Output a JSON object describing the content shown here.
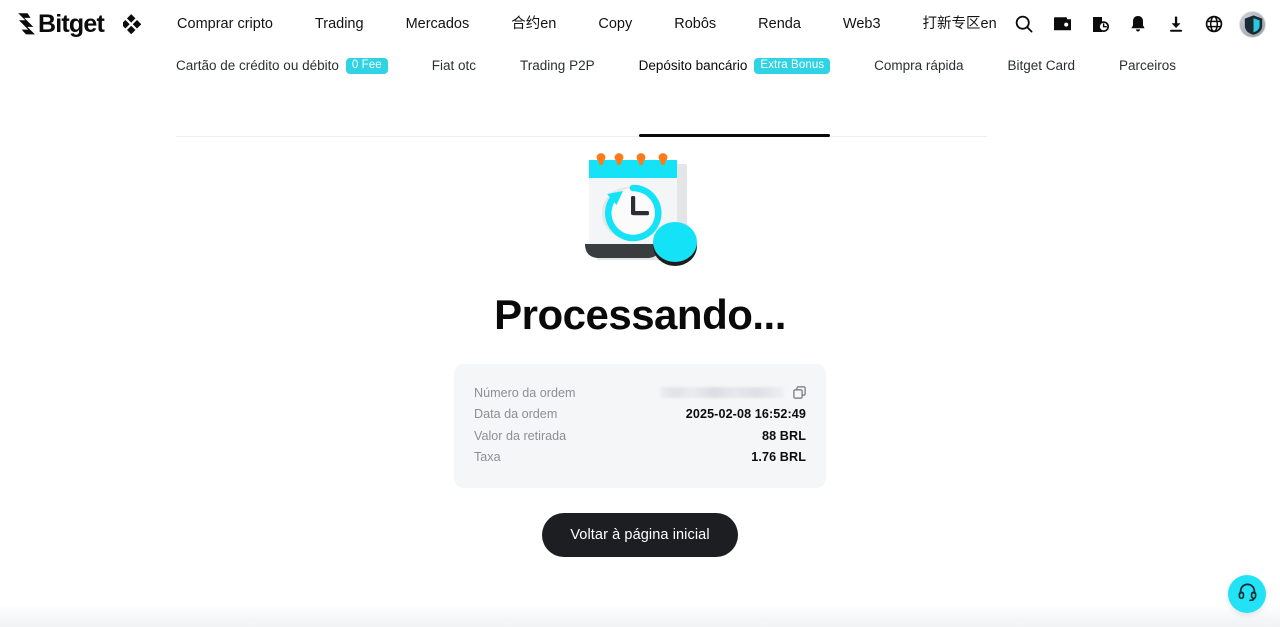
{
  "header": {
    "logo_text": "Bitget",
    "logo_icon": "bitget-logo-mark",
    "apps_icon": "diamond-grid-icon",
    "nav": [
      {
        "label": "Comprar cripto"
      },
      {
        "label": "Trading"
      },
      {
        "label": "Mercados"
      },
      {
        "label": "合约en"
      },
      {
        "label": "Copy"
      },
      {
        "label": "Robôs"
      },
      {
        "label": "Renda"
      },
      {
        "label": "Web3"
      },
      {
        "label": "打新专区en"
      }
    ],
    "icons": [
      {
        "name": "search-icon"
      },
      {
        "name": "wallet-icon"
      },
      {
        "name": "order-history-icon"
      },
      {
        "name": "notification-bell-icon"
      },
      {
        "name": "download-icon"
      },
      {
        "name": "globe-language-icon"
      }
    ],
    "avatar": {
      "name": "user-avatar"
    }
  },
  "tabs": [
    {
      "label": "Cartão de crédito ou débito",
      "badge": "0 Fee",
      "active": false
    },
    {
      "label": "Fiat otc",
      "badge": "",
      "active": false
    },
    {
      "label": "Trading P2P",
      "badge": "",
      "active": false
    },
    {
      "label": "Depósito bancário",
      "badge": "Extra Bonus",
      "active": true
    },
    {
      "label": "Compra rápida",
      "badge": "",
      "active": false
    },
    {
      "label": "Bitget Card",
      "badge": "",
      "active": false
    },
    {
      "label": "Parceiros",
      "badge": "",
      "active": false
    }
  ],
  "main": {
    "illustration": "calendar-clock-processing-illustration",
    "title": "Processando...",
    "details": [
      {
        "label": "Número da ordem",
        "value": "",
        "redacted": true,
        "copy_icon": "copy-icon"
      },
      {
        "label": "Data da ordem",
        "value": "2025-02-08 16:52:49",
        "redacted": false
      },
      {
        "label": "Valor da retirada",
        "value": "88 BRL",
        "redacted": false
      },
      {
        "label": "Taxa",
        "value": "1.76 BRL",
        "redacted": false
      }
    ],
    "primary_button": "Voltar à página inicial"
  },
  "support": {
    "icon": "headset-support-icon"
  },
  "colors": {
    "accent_cyan": "#21e3f5",
    "badge_teal": "#2fd3e3",
    "button_black": "#1c1e21",
    "card_bg": "#f5f6f7",
    "label_gray": "#8b9096",
    "illustration_orange": "#ff7a1a"
  }
}
